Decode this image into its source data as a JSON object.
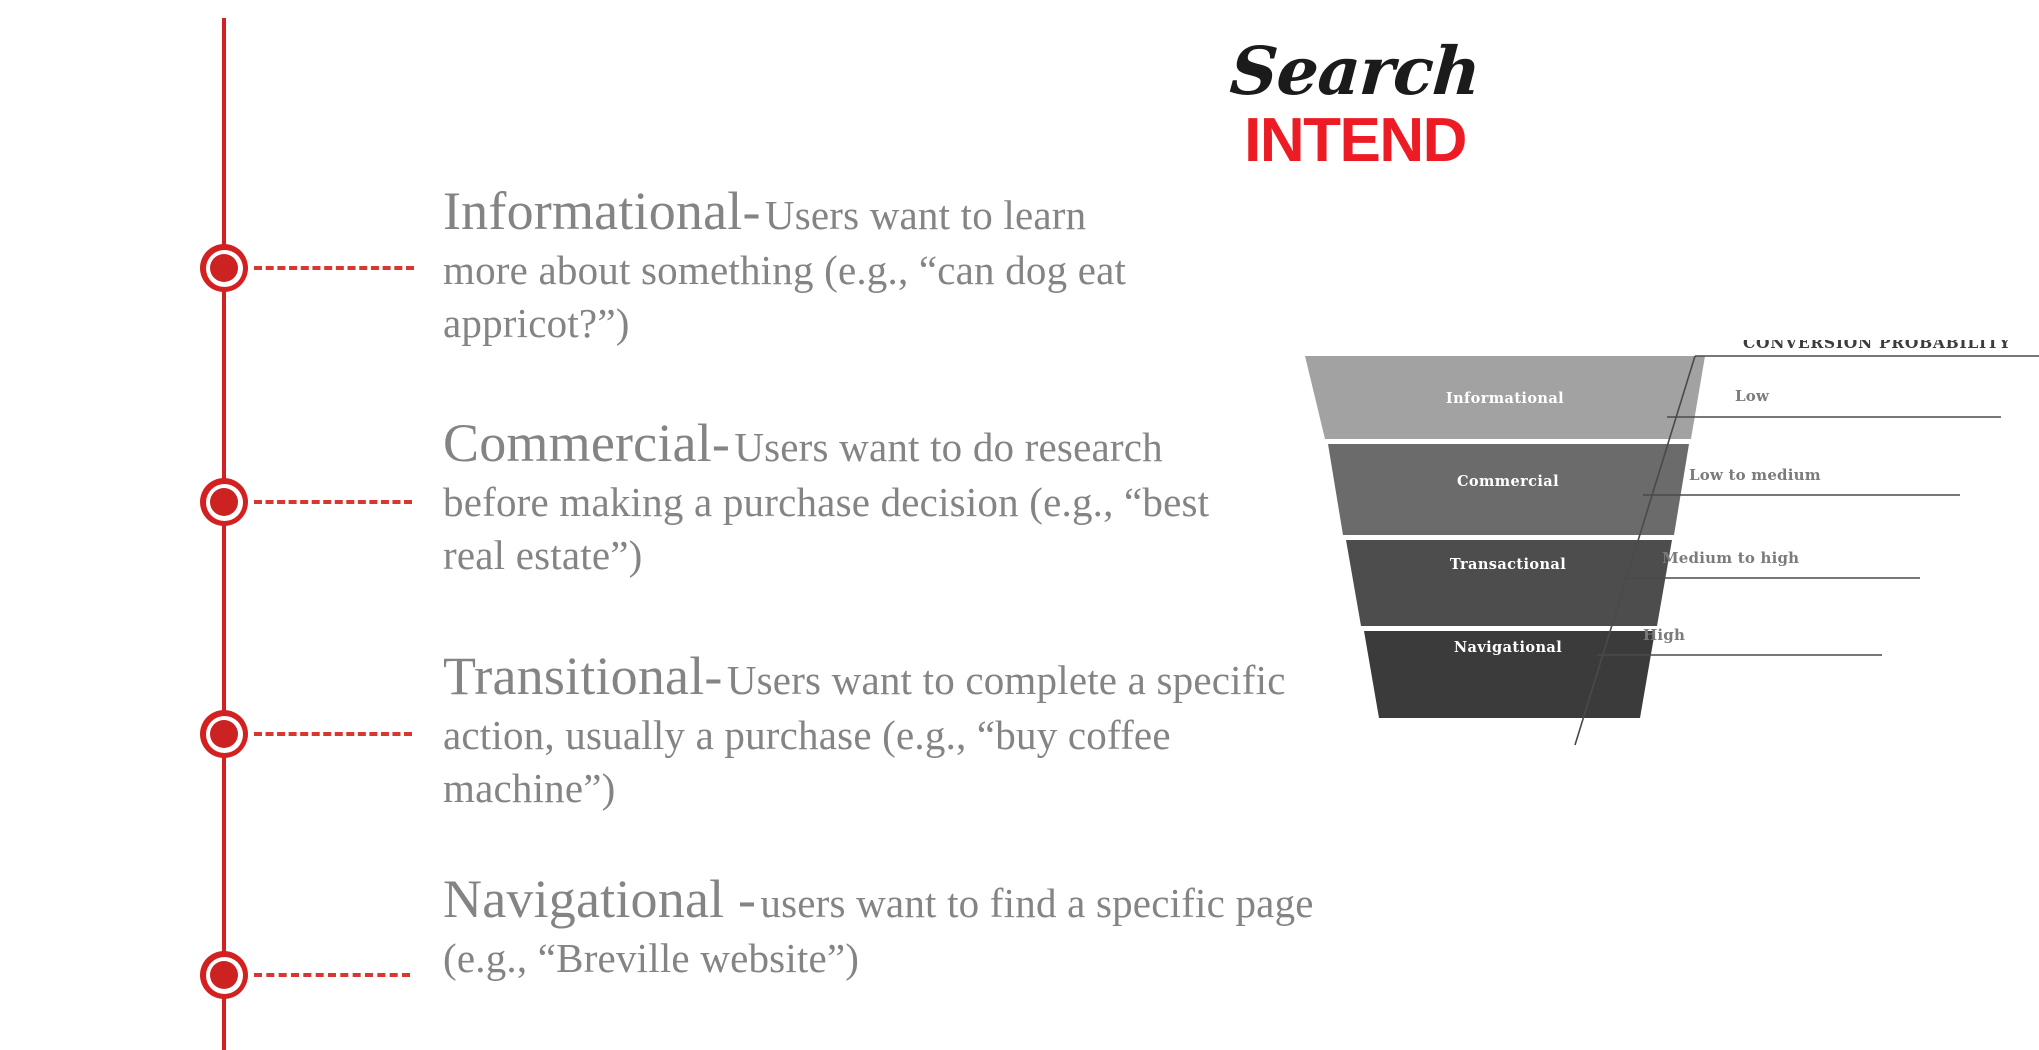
{
  "brand": {
    "word_script": "Search",
    "word_bold": "INTEND"
  },
  "timeline": {
    "marker_count": 4,
    "rail_color": "#d32020",
    "marker_color": "#cc2222"
  },
  "intents": [
    {
      "term": "Informational-",
      "description": "Users want to learn more about something (e.g., “can dog eat appricot?”)"
    },
    {
      "term": "Commercial-",
      "description": "Users want to do research before making a purchase decision (e.g., “best real estate”)"
    },
    {
      "term": "Transitional-",
      "description": "Users want to complete a specific action, usually a purchase (e.g., “buy coffee machine”)"
    },
    {
      "term": "Navigational -",
      "description": "users want to find a specific page (e.g., “Breville website”)"
    }
  ],
  "funnel": {
    "title": "CONVERSION PROBABILITY",
    "segments": [
      {
        "label": "Informational",
        "color": "#a2a2a2",
        "probability": "Low"
      },
      {
        "label": "Commercial",
        "color": "#6b6b6b",
        "probability": "Low to medium"
      },
      {
        "label": "Transactional",
        "color": "#4d4d4d",
        "probability": "Medium to high"
      },
      {
        "label": "Navigational",
        "color": "#3b3b3b",
        "probability": "High"
      }
    ]
  },
  "chart_data": {
    "type": "funnel",
    "title": "CONVERSION PROBABILITY",
    "categories": [
      "Informational",
      "Commercial",
      "Transactional",
      "Navigational"
    ],
    "values": [
      "Low",
      "Low to medium",
      "Medium to high",
      "High"
    ],
    "colors": [
      "#a2a2a2",
      "#6b6b6b",
      "#4d4d4d",
      "#3b3b3b"
    ],
    "xlabel": "",
    "ylabel": "Conversion probability",
    "legend": "none"
  }
}
